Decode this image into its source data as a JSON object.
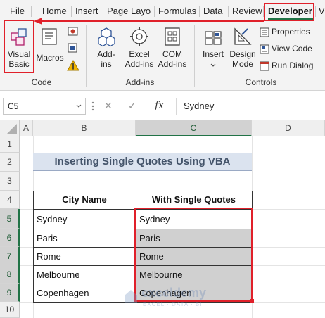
{
  "ribbon_tabs": [
    {
      "label": "File"
    },
    {
      "label": "Home"
    },
    {
      "label": "Insert"
    },
    {
      "label": "Page Layo"
    },
    {
      "label": "Formulas"
    },
    {
      "label": "Data"
    },
    {
      "label": "Review"
    },
    {
      "label": "Developer"
    },
    {
      "label": "V"
    }
  ],
  "code_group": {
    "visual_basic": "Visual Basic",
    "visual_basic_l1": "Visual",
    "visual_basic_l2": "Basic",
    "macros": "Macros",
    "label": "Code"
  },
  "addins_group": {
    "addins_l1": "Add-",
    "addins_l2": "ins",
    "excel_addins_l1": "Excel",
    "excel_addins_l2": "Add-ins",
    "com_addins_l1": "COM",
    "com_addins_l2": "Add-ins",
    "label": "Add-ins"
  },
  "controls_group": {
    "insert": "Insert",
    "design_mode_l1": "Design",
    "design_mode_l2": "Mode",
    "properties": "Properties",
    "view_code": "View Code",
    "run_dialog": "Run Dialog",
    "label": "Controls"
  },
  "formula_bar": {
    "name_box": "C5",
    "fx": "fx",
    "content": "Sydney"
  },
  "columns": [
    "A",
    "B",
    "C",
    "D"
  ],
  "rows": [
    "1",
    "2",
    "3",
    "4",
    "5",
    "6",
    "7",
    "8",
    "9",
    "10"
  ],
  "sheet": {
    "title": "Inserting Single Quotes Using VBA",
    "headers": [
      "City Name",
      "With Single Quotes"
    ],
    "cities": [
      "Sydney",
      "Paris",
      "Rome",
      "Melbourne",
      "Copenhagen"
    ],
    "quoted": [
      "Sydney",
      "Paris",
      "Rome",
      "Melbourne",
      "Copenhagen"
    ]
  },
  "colors": {
    "accent_green": "#217346",
    "highlight_red": "#e0202a",
    "title_fill": "#dbe3ef",
    "selection_fill": "#d0d0d0"
  },
  "watermark": {
    "brand": "exceldemy",
    "tagline": "EXCEL · DATA · BI"
  }
}
